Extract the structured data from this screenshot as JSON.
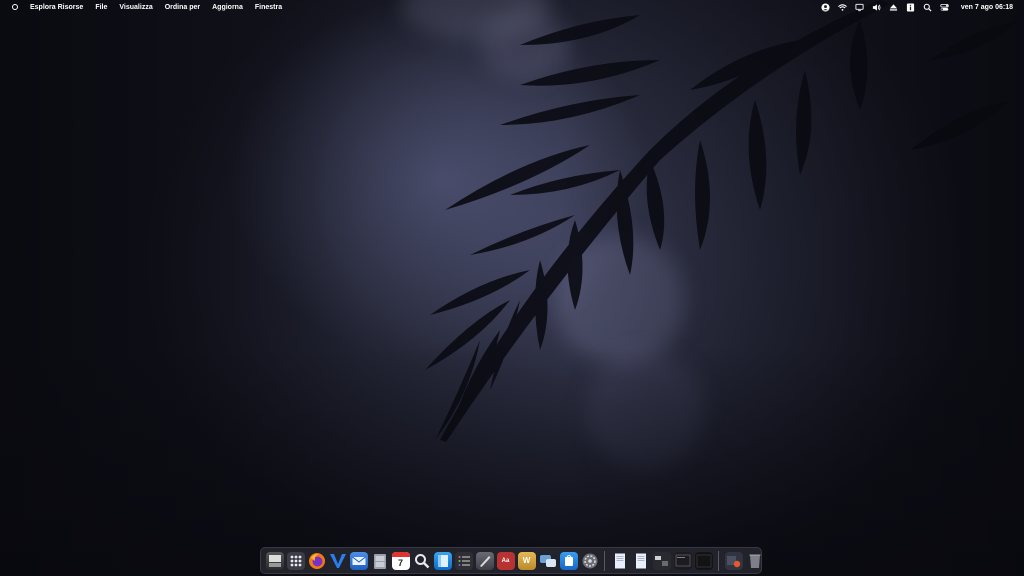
{
  "menubar": {
    "app_name": "Esplora Risorse",
    "menus": [
      "File",
      "Visualizza",
      "Ordina per",
      "Aggiorna",
      "Finestra"
    ],
    "status_icons": [
      "user-icon",
      "wifi-icon",
      "display-icon",
      "volume-icon",
      "eject-icon",
      "info-icon",
      "search-icon",
      "control-center-icon"
    ],
    "clock": "ven 7 ago 06:18"
  },
  "dock": {
    "apps": [
      {
        "name": "finder",
        "color": "#3a3a40"
      },
      {
        "name": "launchpad",
        "color": "#4a4a55"
      },
      {
        "name": "firefox",
        "color": "#e66000"
      },
      {
        "name": "vivaldi",
        "color": "#1e63c4"
      },
      {
        "name": "mail",
        "color": "#2d6ecf"
      },
      {
        "name": "file-cabinet",
        "color": "#8a8d95"
      },
      {
        "name": "calendar",
        "color": "#ffffff",
        "label": "7"
      },
      {
        "name": "spotlight",
        "color": "#2a2a30"
      },
      {
        "name": "notes-blue",
        "color": "#1a8be0"
      },
      {
        "name": "tasks",
        "color": "#333338"
      },
      {
        "name": "script-editor",
        "color": "#555560"
      },
      {
        "name": "dictionary",
        "color": "#b03030",
        "label": "Aa"
      },
      {
        "name": "word",
        "color": "#d0a040",
        "label": "W"
      },
      {
        "name": "messages",
        "color": "#4a7cb0"
      },
      {
        "name": "app-store",
        "color": "#1f7ad8"
      },
      {
        "name": "system-preferences",
        "color": "#5a5a62"
      }
    ],
    "documents": [
      {
        "name": "document-1",
        "color": "#dfe6f5"
      },
      {
        "name": "document-2",
        "color": "#dfe6f5"
      },
      {
        "name": "window-preview-1",
        "color": "#2b2b2e"
      },
      {
        "name": "window-preview-2",
        "color": "#1e1e22"
      },
      {
        "name": "window-preview-3",
        "color": "#151517"
      }
    ],
    "trailing": [
      {
        "name": "downloads-stack",
        "color": "#3a3f4a"
      },
      {
        "name": "trash",
        "color": "#70737a"
      }
    ]
  }
}
